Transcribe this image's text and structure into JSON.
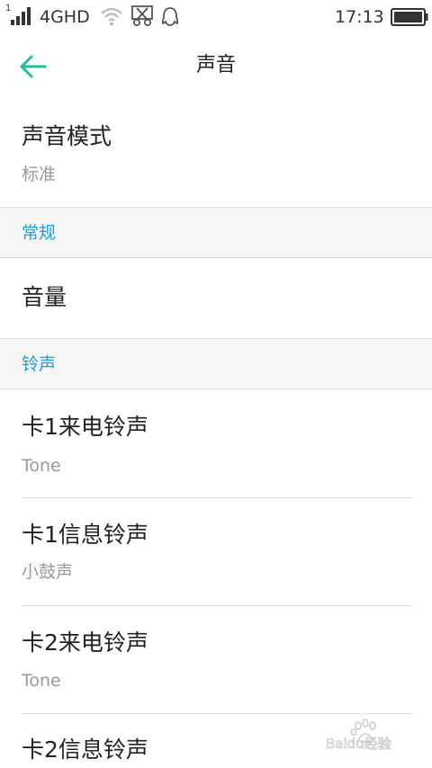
{
  "status_bar": {
    "sim_index": "1",
    "network": "4GHD",
    "time": "17:13",
    "icons": [
      "signal-icon",
      "wifi-icon",
      "scissors-icon",
      "qq-icon",
      "battery-icon"
    ]
  },
  "header": {
    "title": "声音",
    "back_icon": "back-arrow-icon"
  },
  "sound_mode": {
    "label": "声音模式",
    "value": "标准"
  },
  "sections": {
    "general": "常规",
    "ringtone": "铃声"
  },
  "volume": {
    "label": "音量"
  },
  "ringtones": [
    {
      "label": "卡1来电铃声",
      "value": "Tone"
    },
    {
      "label": "卡1信息铃声",
      "value": "小鼓声"
    },
    {
      "label": "卡2来电铃声",
      "value": "Tone"
    },
    {
      "label": "卡2信息铃声",
      "value": ""
    }
  ],
  "watermark": {
    "text": "Baidu经验"
  },
  "colors": {
    "accent": "#1e9ce0",
    "back_arrow": "#1fbf9a",
    "section_bg": "#f6f6f6",
    "secondary_text": "#9a9a9a"
  }
}
